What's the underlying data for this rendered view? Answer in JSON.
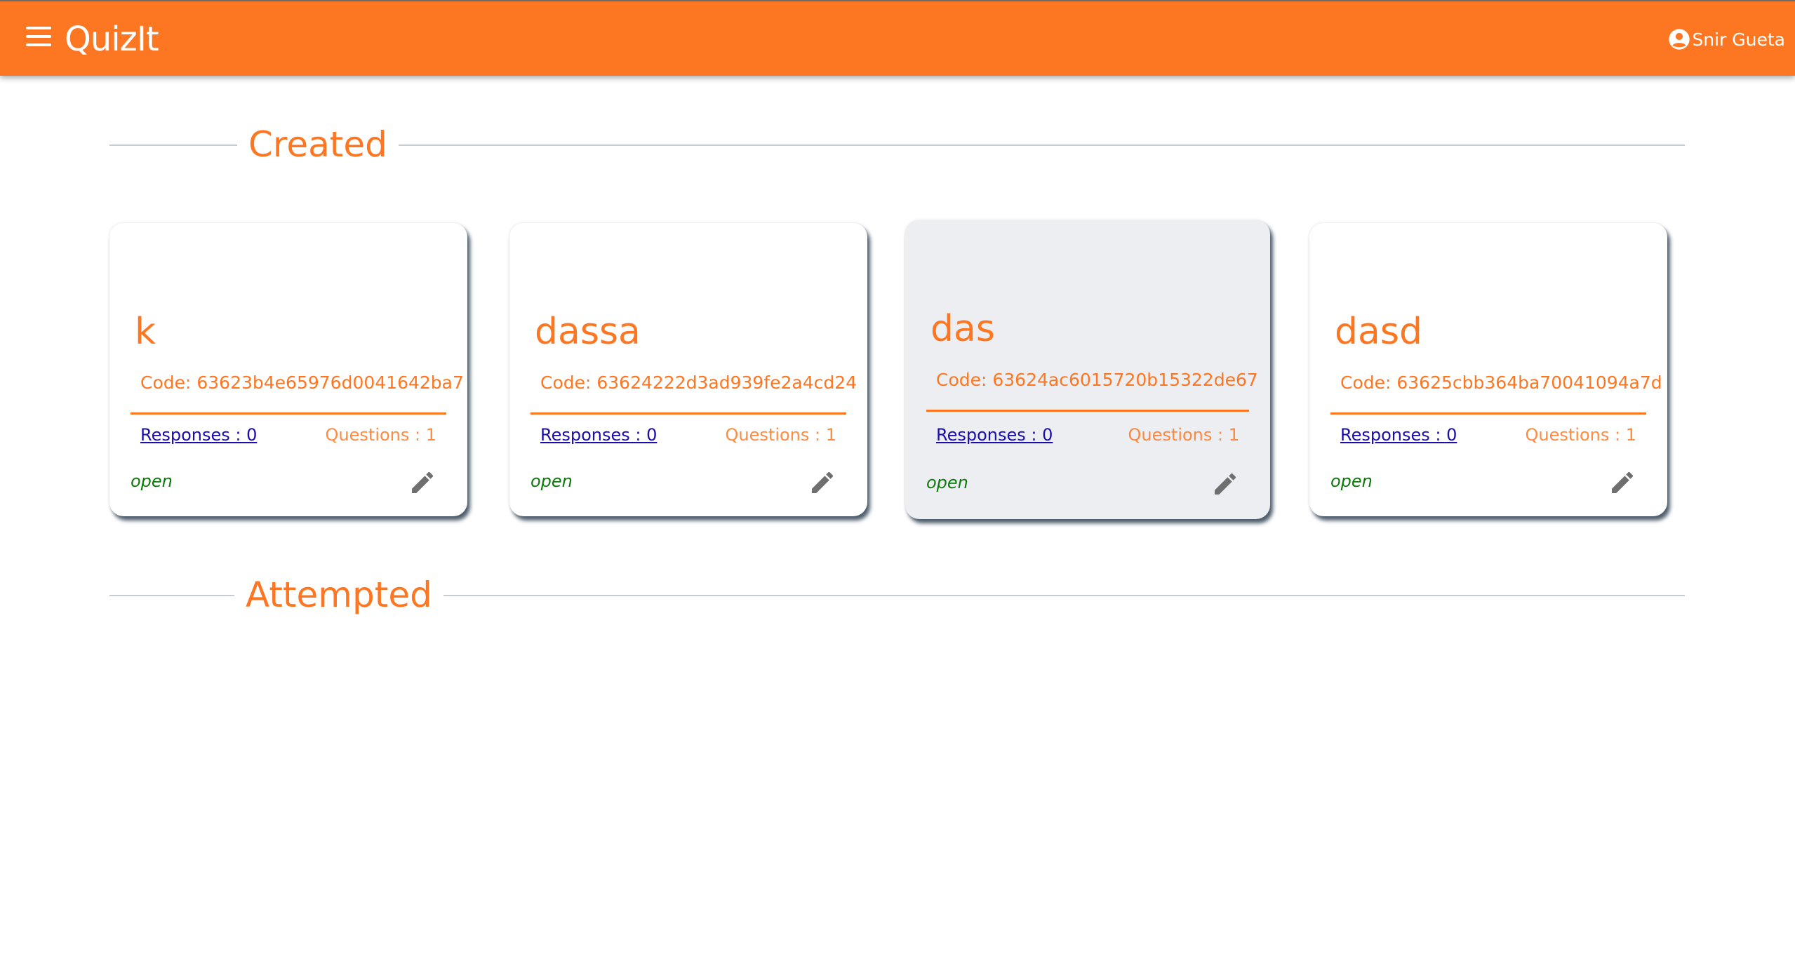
{
  "app": {
    "title": "QuizIt",
    "user_name": "Snir Gueta",
    "icons": {
      "menu": "menu-icon",
      "account": "account-circle-icon",
      "edit": "pencil-icon"
    },
    "colors": {
      "primary": "#fd7722",
      "link": "#1a0dab",
      "status_open": "#0b7a0b",
      "card_hover": "#eceef2"
    }
  },
  "sections": {
    "created": "Created",
    "attempted": "Attempted"
  },
  "cards": [
    {
      "title": "k",
      "code": "Code: 63623b4e65976d0041642ba7",
      "responses": "Responses : 0",
      "questions": "Questions : 1",
      "status": "open"
    },
    {
      "title": "dassa",
      "code": "Code: 63624222d3ad939fe2a4cd24",
      "responses": "Responses : 0",
      "questions": "Questions : 1",
      "status": "open"
    },
    {
      "title": "das",
      "code": "Code: 63624ac6015720b15322de67",
      "responses": "Responses : 0",
      "questions": "Questions : 1",
      "status": "open"
    },
    {
      "title": "dasd",
      "code": "Code: 63625cbb364ba70041094a7d",
      "responses": "Responses : 0",
      "questions": "Questions : 1",
      "status": "open"
    }
  ]
}
